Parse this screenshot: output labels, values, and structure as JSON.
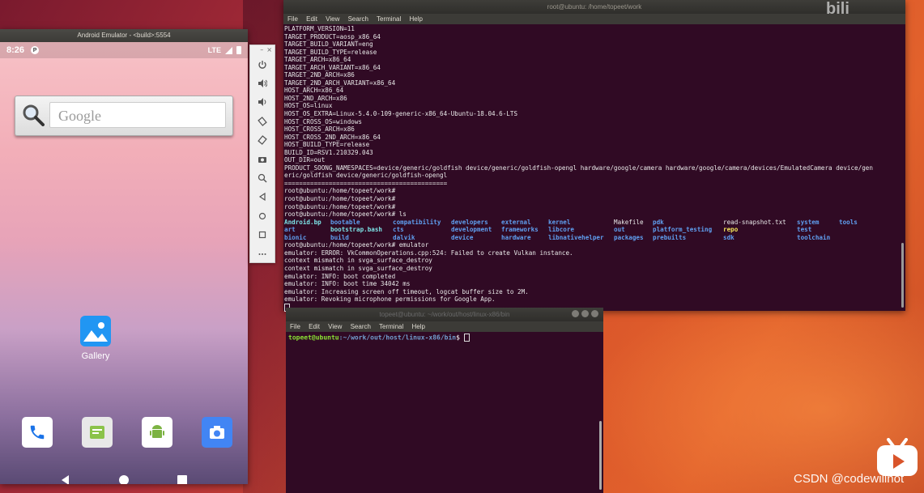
{
  "emulator": {
    "title": "Android Emulator - <build>:5554",
    "status": {
      "time": "8:26",
      "network": "LTE"
    },
    "search_widget": {
      "placeholder": "Google"
    },
    "gallery_label": "Gallery",
    "dock": [
      "phone-app",
      "messages-app",
      "android-app",
      "camera-app"
    ],
    "toolbar": [
      "power",
      "volume-up",
      "volume-down",
      "rotate-left",
      "rotate-right",
      "screenshot",
      "zoom",
      "back",
      "home",
      "overview",
      "more"
    ]
  },
  "terminal1": {
    "title": "root@ubuntu: /home/topeet/work",
    "menu": [
      "File",
      "Edit",
      "View",
      "Search",
      "Terminal",
      "Help"
    ],
    "lines_before": [
      "PLATFORM_VERSION=11",
      "TARGET_PRODUCT=aosp_x86_64",
      "TARGET_BUILD_VARIANT=eng",
      "TARGET_BUILD_TYPE=release",
      "TARGET_ARCH=x86_64",
      "TARGET_ARCH_VARIANT=x86_64",
      "TARGET_2ND_ARCH=x86",
      "TARGET_2ND_ARCH_VARIANT=x86_64",
      "HOST_ARCH=x86_64",
      "HOST_2ND_ARCH=x86",
      "HOST_OS=linux",
      "HOST_OS_EXTRA=Linux-5.4.0-109-generic-x86_64-Ubuntu-18.04.6-LTS",
      "HOST_CROSS_OS=windows",
      "HOST_CROSS_ARCH=x86",
      "HOST_CROSS_2ND_ARCH=x86_64",
      "HOST_BUILD_TYPE=release",
      "BUILD_ID=RSV1.210329.043",
      "OUT_DIR=out",
      "PRODUCT_SOONG_NAMESPACES=device/generic/goldfish device/generic/goldfish-opengl hardware/google/camera hardware/google/camera/devices/EmulatedCamera device/gen",
      "eric/goldfish device/generic/goldfish-opengl",
      "============================================",
      "root@ubuntu:/home/topeet/work#",
      "root@ubuntu:/home/topeet/work#",
      "root@ubuntu:/home/topeet/work#",
      "root@ubuntu:/home/topeet/work# ls"
    ],
    "ls_rows": [
      [
        [
          "Android.bp",
          "link"
        ],
        [
          "bootable",
          "dir"
        ],
        [
          "compatibility",
          "dir"
        ],
        [
          "developers",
          "dir"
        ],
        [
          "external",
          "dir"
        ],
        [
          "kernel",
          "dir"
        ],
        [
          "Makefile",
          "file"
        ],
        [
          "pdk",
          "dir"
        ],
        [
          "read-snapshot.txt",
          "file"
        ],
        [
          "system",
          "dir"
        ],
        [
          "tools",
          "dir"
        ]
      ],
      [
        [
          "art",
          "dir"
        ],
        [
          "bootstrap.bash",
          "link"
        ],
        [
          "cts",
          "dir"
        ],
        [
          "development",
          "dir"
        ],
        [
          "frameworks",
          "dir"
        ],
        [
          "libcore",
          "dir"
        ],
        [
          "out",
          "dir"
        ],
        [
          "platform_testing",
          "dir"
        ],
        [
          "repo",
          "ex"
        ],
        [
          "test",
          "dir"
        ],
        [
          "",
          ""
        ]
      ],
      [
        [
          "bionic",
          "dir"
        ],
        [
          "build",
          "dir"
        ],
        [
          "dalvik",
          "dir"
        ],
        [
          "device",
          "dir"
        ],
        [
          "hardware",
          "dir"
        ],
        [
          "libnativehelper",
          "dir"
        ],
        [
          "packages",
          "dir"
        ],
        [
          "prebuilts",
          "dir"
        ],
        [
          "sdk",
          "dir"
        ],
        [
          "toolchain",
          "dir"
        ],
        [
          "",
          ""
        ]
      ]
    ],
    "lines_after": [
      "root@ubuntu:/home/topeet/work# emulator",
      "emulator: ERROR: VkCommonOperations.cpp:524: Failed to create Vulkan instance.",
      "context mismatch in svga_surface_destroy",
      "context mismatch in svga_surface_destroy",
      "emulator: INFO: boot completed",
      "emulator: INFO: boot time 34042 ms",
      "emulator: Increasing screen off timeout, logcat buffer size to 2M.",
      "emulator: Revoking microphone permissions for Google App."
    ]
  },
  "terminal2": {
    "title": "topeet@ubuntu: ~/work/out/host/linux-x86/bin",
    "menu": [
      "File",
      "Edit",
      "View",
      "Search",
      "Terminal",
      "Help"
    ],
    "prompt_user": "topeet@ubuntu",
    "prompt_path": ":~/work/out/host/linux-x86/bin",
    "prompt_symbol": "$ "
  },
  "watermark": "CSDN @codewillnot",
  "colors": {
    "terminal_bg": "#300a24",
    "dir": "#5f9ff0",
    "exec": "#f0e35a",
    "link": "#7be0e4",
    "prompt_user": "#8ae234",
    "prompt_path": "#729fcf"
  }
}
